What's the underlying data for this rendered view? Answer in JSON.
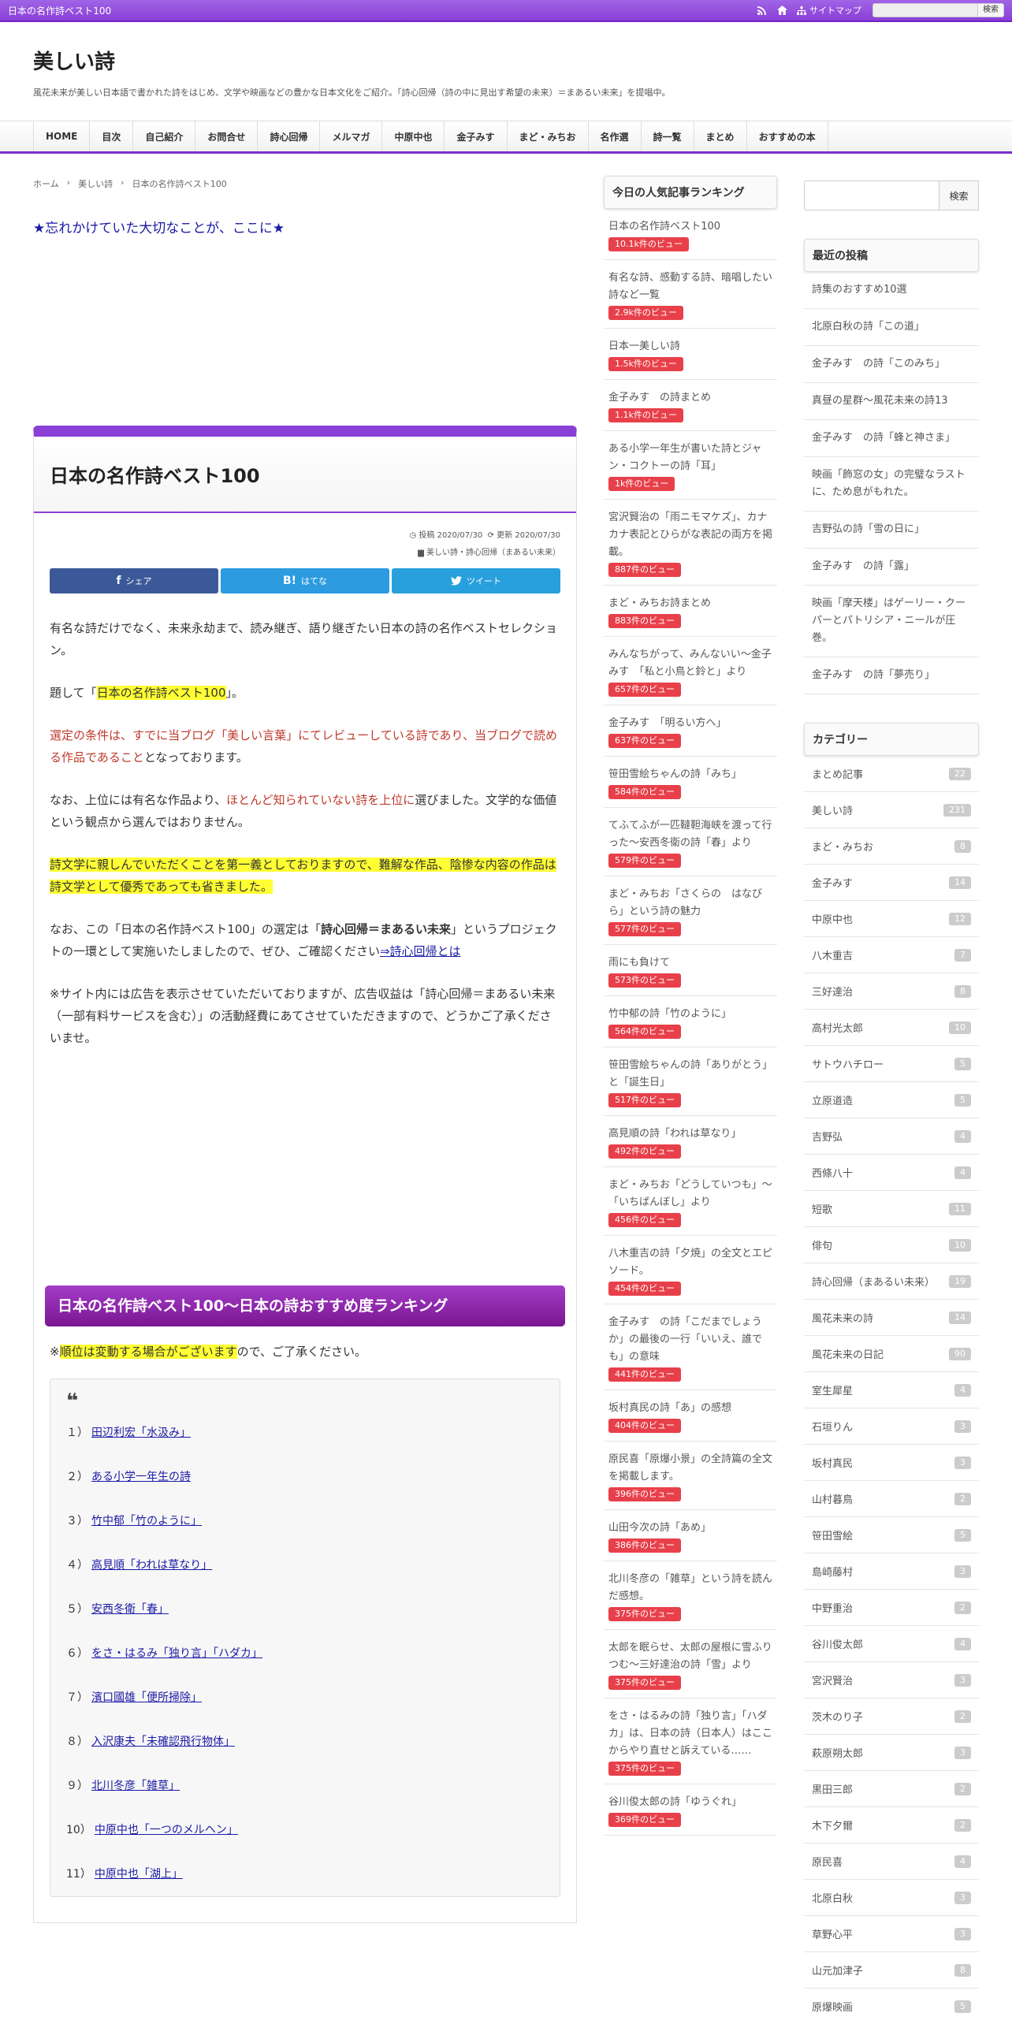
{
  "topbar": {
    "title": "日本の名作詩ベスト100",
    "sitemap": "サイトマップ",
    "search_button": "検索"
  },
  "header": {
    "title": "美しい詩",
    "description": "風花未来が美しい日本語で書かれた詩をはじめ、文学や映画などの豊かな日本文化をご紹介。「詩心回帰（詩の中に見出す希望の未来）＝まあるい未来」を提唱中。"
  },
  "nav": [
    "HOME",
    "目次",
    "自己紹介",
    "お問合せ",
    "詩心回帰",
    "メルマガ",
    "中原中也",
    "金子みす",
    "まど・みちお",
    "名作選",
    "詩一覧",
    "まとめ",
    "おすすめの本"
  ],
  "breadcrumb": [
    "ホーム",
    "美しい詩",
    "日本の名作詩ベスト100"
  ],
  "catch": "★忘れかけていた大切なことが、ここに★",
  "article": {
    "title": "日本の名作詩ベスト100",
    "posted": "投稿 2020/07/30",
    "updated": "更新 2020/07/30",
    "category": "美しい詩・詩心回帰（まあるい未来）",
    "share": {
      "fb": "シェア",
      "hb": "はてな",
      "tw": "ツイート"
    },
    "p1": "有名な詩だけでなく、未来永劫まで、読み継ぎ、語り継ぎたい日本の詩の名作ベストセレクション。",
    "p2a": "題して「",
    "p2b": "日本の名作詩ベスト100",
    "p2c": "」。",
    "p3a": "選定の条件は、すでに当ブログ「美しい言葉」にてレビューしている詩であり、当ブログで読める作品であること",
    "p3b": "となっております。",
    "p4a": "なお、上位には有名な作品より、",
    "p4b": "ほとんど知られていない詩を上位に",
    "p4c": "選びました。文学的な価値という観点から選んではおりません。",
    "p5": "詩文学に親しんでいただくことを第一義としておりますので、難解な作品、陰惨な内容の作品は詩文学として優秀であっても省きました。",
    "p6a": "なお、この「日本の名作詩ベスト100」の選定は「",
    "p6b": "詩心回帰＝まあるい未来",
    "p6c": "」というプロジェクトの一環として実施いたしましたので、ぜひ、ご確認ください",
    "p6d": "⇒詩心回帰とは",
    "p7": "※サイト内には広告を表示させていただいておりますが、広告収益は「詩心回帰＝まあるい未来（一部有料サービスを含む）」の活動経費にあてさせていただきますので、どうかご了承くださいませ。",
    "h2": "日本の名作詩ベスト100～日本の詩おすすめ度ランキング",
    "notea": "※",
    "noteb": "順位は変動する場合がございます",
    "notec": "ので、ご了承ください。",
    "ranking": [
      {
        "n": "１）",
        "t": "田辺利宏「水汲み」"
      },
      {
        "n": "２）",
        "t": "ある小学一年生の詩"
      },
      {
        "n": "３）",
        "t": "竹中郁「竹のように」"
      },
      {
        "n": "４）",
        "t": "高見順「われは草なり」"
      },
      {
        "n": "５）",
        "t": "安西冬衛「春」"
      },
      {
        "n": "６）",
        "t": "をさ・はるみ「独り言」「ハダカ」"
      },
      {
        "n": "７）",
        "t": "濱口國雄「便所掃除」"
      },
      {
        "n": "８）",
        "t": "入沢康夫「未確認飛行物体」"
      },
      {
        "n": "９）",
        "t": "北川冬彦「雑草」"
      },
      {
        "n": "10）",
        "t": "中原中也「一つのメルヘン」"
      },
      {
        "n": "11）",
        "t": "中原中也「湖上」"
      }
    ]
  },
  "popular": {
    "heading": "今日の人気記事ランキング",
    "items": [
      {
        "t": "日本の名作詩ベスト100",
        "v": "10.1k件のビュー"
      },
      {
        "t": "有名な詩、感動する詩、暗唱したい詩など一覧",
        "v": "2.9k件のビュー"
      },
      {
        "t": "日本一美しい詩",
        "v": "1.5k件のビュー"
      },
      {
        "t": "金子みす　の詩まとめ",
        "v": "1.1k件のビュー"
      },
      {
        "t": "ある小学一年生が書いた詩とジャン・コクトーの詩「耳」",
        "v": "1k件のビュー"
      },
      {
        "t": "宮沢賢治の「雨ニモマケズ」、カナカナ表記とひらがな表記の両方を掲載。",
        "v": "887件のビュー"
      },
      {
        "t": "まど・みちお詩まとめ",
        "v": "883件のビュー"
      },
      {
        "t": "みんなちがって、みんないい～金子みす　「私と小鳥と鈴と」より",
        "v": "657件のビュー"
      },
      {
        "t": "金子みす　「明るい方へ」",
        "v": "637件のビュー"
      },
      {
        "t": "笹田雪絵ちゃんの詩「みち」",
        "v": "584件のビュー"
      },
      {
        "t": "てふてふが一匹韃靼海峡を渡って行った～安西冬衛の詩「春」より",
        "v": "579件のビュー"
      },
      {
        "t": "まど・みちお「さくらの　はなびら」という詩の魅力",
        "v": "577件のビュー"
      },
      {
        "t": "雨にも負けて",
        "v": "573件のビュー"
      },
      {
        "t": "竹中郁の詩「竹のように」",
        "v": "564件のビュー"
      },
      {
        "t": "笹田雪絵ちゃんの詩「ありがとう」と「誕生日」",
        "v": "517件のビュー"
      },
      {
        "t": "高見順の詩「われは草なり」",
        "v": "492件のビュー"
      },
      {
        "t": "まど・みちお「どうしていつも」～「いちばんぼし」より",
        "v": "456件のビュー"
      },
      {
        "t": "八木重吉の詩「夕焼」の全文とエピソード。",
        "v": "454件のビュー"
      },
      {
        "t": "金子みす　の詩「こだまでしょうか」の最後の一行「いいえ、誰でも」の意味",
        "v": "441件のビュー"
      },
      {
        "t": "坂村真民の詩「あ」の感想",
        "v": "404件のビュー"
      },
      {
        "t": "原民喜「原爆小景」の全詩篇の全文を掲載します。",
        "v": "396件のビュー"
      },
      {
        "t": "山田今次の詩「あめ」",
        "v": "386件のビュー"
      },
      {
        "t": "北川冬彦の「雑草」という詩を読んだ感想。",
        "v": "375件のビュー"
      },
      {
        "t": "太郎を眠らせ、太郎の屋根に雪ふりつむ～三好達治の詩「雪」より",
        "v": "375件のビュー"
      },
      {
        "t": "をさ・はるみの詩「独り言」「ハダカ」は、日本の詩（日本人）はここからやり直せと訴えている……",
        "v": "375件のビュー"
      },
      {
        "t": "谷川俊太郎の詩「ゆうぐれ」",
        "v": "369件のビュー"
      }
    ]
  },
  "sidebar": {
    "search_button": "検索",
    "recent_heading": "最近の投稿",
    "recent": [
      "詩集のおすすめ10選",
      "北原白秋の詩「この道」",
      "金子みす　の詩「このみち」",
      "真昼の星群～風花未来の詩13",
      "金子みす　の詩「蜂と神さま」",
      "映画「飾窓の女」の完璧なラストに、ため息がもれた。",
      "吉野弘の詩「雪の日に」",
      "金子みす　の詩「露」",
      "映画「摩天楼」はゲーリー・クーパーとパトリシア・ニールが圧巻。",
      "金子みす　の詩「夢売り」"
    ],
    "cat_heading": "カテゴリー",
    "categories": [
      {
        "n": "まとめ記事",
        "c": "22"
      },
      {
        "n": "美しい詩",
        "c": "231"
      },
      {
        "n": "まど・みちお",
        "c": "8"
      },
      {
        "n": "金子みす",
        "c": "14"
      },
      {
        "n": "中原中也",
        "c": "12"
      },
      {
        "n": "八木重吉",
        "c": "7"
      },
      {
        "n": "三好達治",
        "c": "8"
      },
      {
        "n": "高村光太郎",
        "c": "10"
      },
      {
        "n": "サトウハチロー",
        "c": "5"
      },
      {
        "n": "立原道造",
        "c": "5"
      },
      {
        "n": "吉野弘",
        "c": "4"
      },
      {
        "n": "西條八十",
        "c": "4"
      },
      {
        "n": "短歌",
        "c": "11"
      },
      {
        "n": "俳句",
        "c": "10"
      },
      {
        "n": "詩心回帰（まあるい未来）",
        "c": "19"
      },
      {
        "n": "風花未来の詩",
        "c": "14"
      },
      {
        "n": "風花未来の日記",
        "c": "90"
      },
      {
        "n": "室生犀星",
        "c": "4"
      },
      {
        "n": "石垣りん",
        "c": "3"
      },
      {
        "n": "坂村真民",
        "c": "3"
      },
      {
        "n": "山村暮鳥",
        "c": "2"
      },
      {
        "n": "笹田雪絵",
        "c": "5"
      },
      {
        "n": "島崎藤村",
        "c": "3"
      },
      {
        "n": "中野重治",
        "c": "2"
      },
      {
        "n": "谷川俊太郎",
        "c": "4"
      },
      {
        "n": "宮沢賢治",
        "c": "3"
      },
      {
        "n": "茨木のり子",
        "c": "2"
      },
      {
        "n": "萩原朔太郎",
        "c": "3"
      },
      {
        "n": "黒田三郎",
        "c": "2"
      },
      {
        "n": "木下夕爾",
        "c": "2"
      },
      {
        "n": "原民喜",
        "c": "4"
      },
      {
        "n": "北原白秋",
        "c": "3"
      },
      {
        "n": "草野心平",
        "c": "3"
      },
      {
        "n": "山元加津子",
        "c": "8"
      },
      {
        "n": "原爆映画",
        "c": "5"
      }
    ]
  }
}
